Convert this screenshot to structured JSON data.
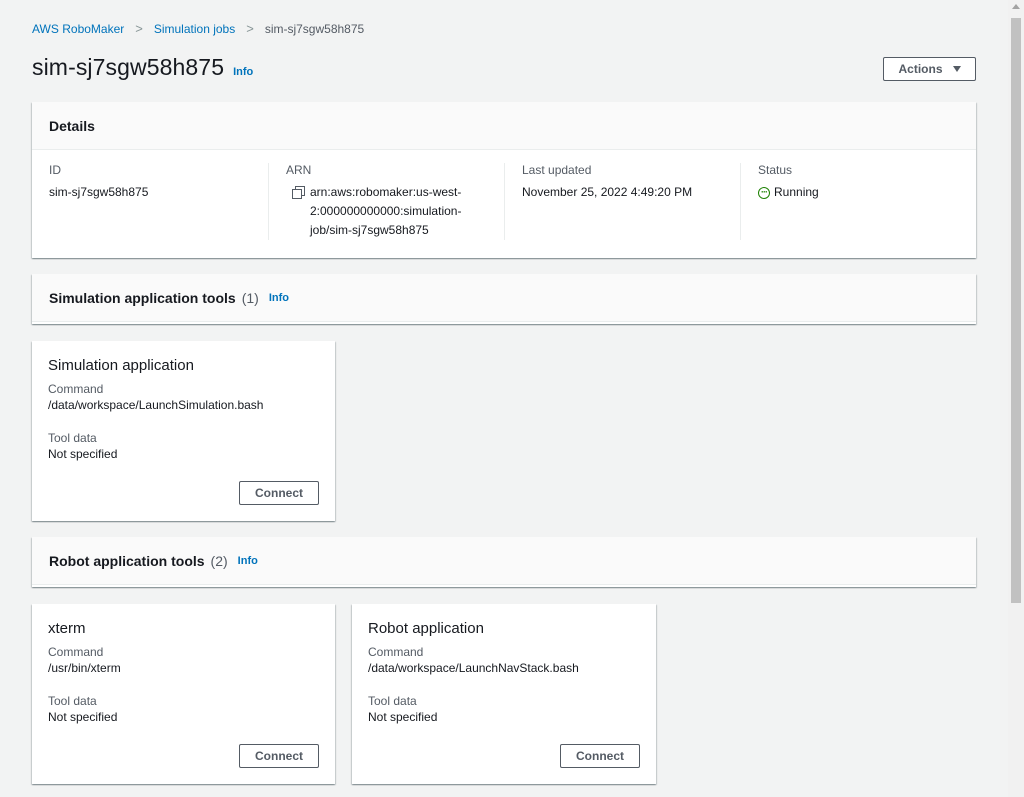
{
  "breadcrumb": {
    "root": "AWS RoboMaker",
    "parent": "Simulation jobs",
    "current": "sim-sj7sgw58h875"
  },
  "page": {
    "title": "sim-sj7sgw58h875",
    "info": "Info",
    "actions_label": "Actions"
  },
  "details": {
    "header": "Details",
    "id_label": "ID",
    "id_value": "sim-sj7sgw58h875",
    "arn_label": "ARN",
    "arn_value": "arn:aws:robomaker:us-west-2:000000000000:simulation-job/sim-sj7sgw58h875",
    "updated_label": "Last updated",
    "updated_value": "November 25, 2022 4:49:20 PM",
    "status_label": "Status",
    "status_value": "Running",
    "status_color": "#1d8102"
  },
  "sim_tools": {
    "title": "Simulation application tools",
    "count": "(1)",
    "info": "Info",
    "cards": [
      {
        "title": "Simulation application",
        "command_label": "Command",
        "command_value": "/data/workspace/LaunchSimulation.bash",
        "tool_data_label": "Tool data",
        "tool_data_value": "Not specified",
        "connect_label": "Connect"
      }
    ]
  },
  "robot_tools": {
    "title": "Robot application tools",
    "count": "(2)",
    "info": "Info",
    "cards": [
      {
        "title": "xterm",
        "command_label": "Command",
        "command_value": "/usr/bin/xterm",
        "tool_data_label": "Tool data",
        "tool_data_value": "Not specified",
        "connect_label": "Connect"
      },
      {
        "title": "Robot application",
        "command_label": "Command",
        "command_value": "/data/workspace/LaunchNavStack.bash",
        "tool_data_label": "Tool data",
        "tool_data_value": "Not specified",
        "connect_label": "Connect"
      }
    ]
  },
  "colors": {
    "link": "#0073bb",
    "background": "#f2f3f3"
  }
}
